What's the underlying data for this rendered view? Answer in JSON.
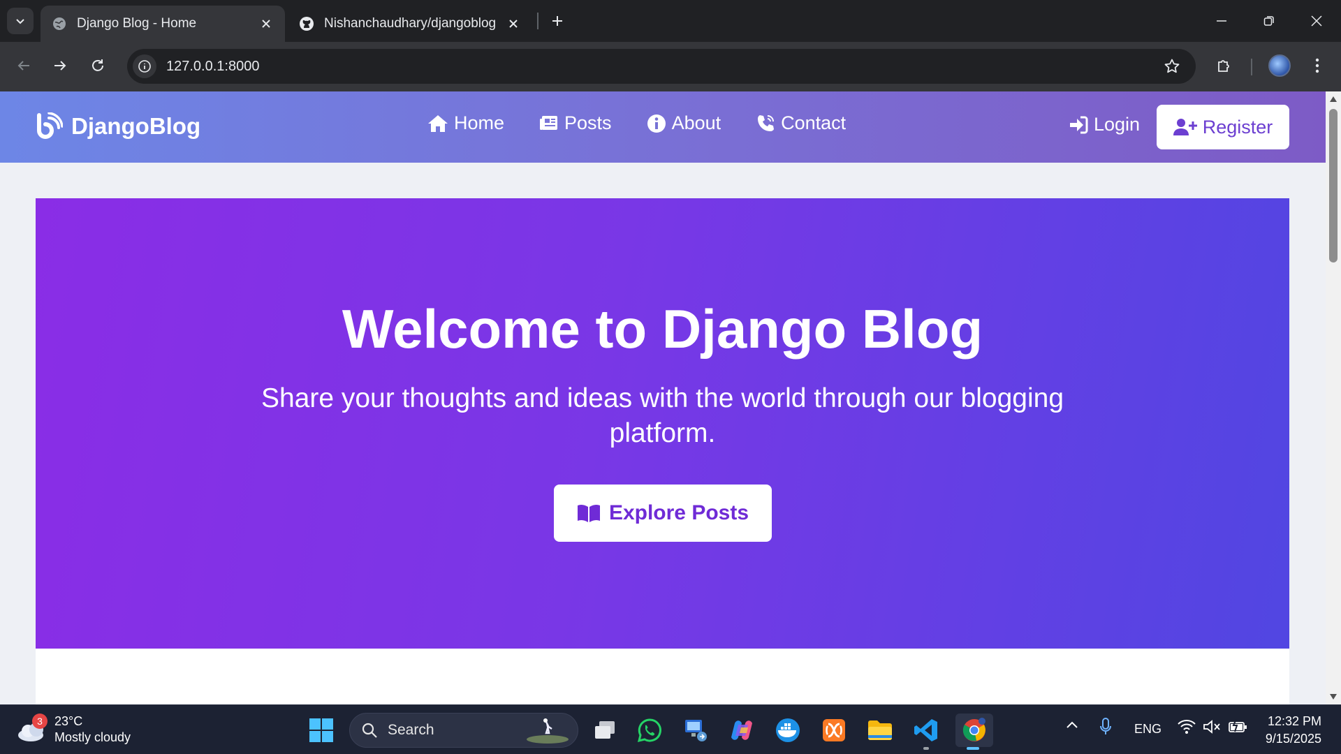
{
  "browser": {
    "tabs": [
      {
        "title": "Django Blog - Home",
        "active": true,
        "icon": "globe-icon"
      },
      {
        "title": "Nishanchaudhary/djangoblog",
        "active": false,
        "icon": "github-icon"
      }
    ],
    "url": "127.0.0.1:8000"
  },
  "site": {
    "brand": "DjangoBlog",
    "nav": [
      {
        "label": "Home",
        "icon": "home-icon"
      },
      {
        "label": "Posts",
        "icon": "newspaper-icon"
      },
      {
        "label": "About",
        "icon": "info-circle-icon"
      },
      {
        "label": "Contact",
        "icon": "phone-icon"
      }
    ],
    "login_label": "Login",
    "register_label": "Register",
    "hero": {
      "title": "Welcome to Django Blog",
      "subtitle": "Share your thoughts and ideas with the world through our blogging platform.",
      "button_label": "Explore Posts"
    },
    "colors": {
      "nav_gradient_start": "#6d86e6",
      "nav_gradient_end": "#7d5bc6",
      "hero_gradient_start": "#8a2de6",
      "hero_gradient_end": "#5146e2"
    }
  },
  "taskbar": {
    "weather": {
      "temp": "23°C",
      "condition": "Mostly cloudy",
      "badge": "3"
    },
    "search_placeholder": "Search",
    "apps": [
      "windows-start-icon",
      "task-view-icon",
      "whatsapp-icon",
      "remote-desktop-icon",
      "copilot-icon",
      "docker-icon",
      "xampp-icon",
      "file-explorer-icon",
      "vscode-icon",
      "chrome-icon"
    ],
    "language": "ENG",
    "time": "12:32 PM",
    "date": "9/15/2025"
  }
}
